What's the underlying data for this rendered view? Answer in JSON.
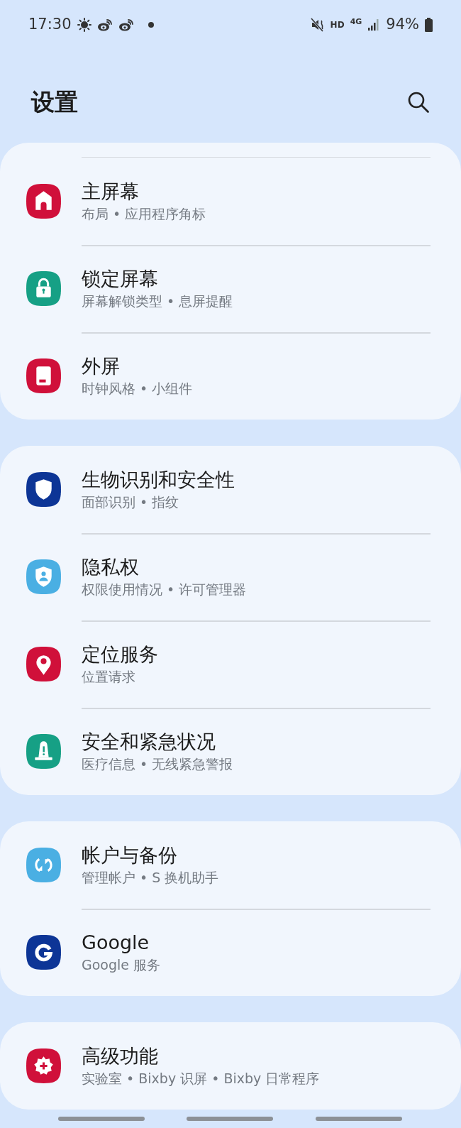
{
  "status_bar": {
    "time": "17:30",
    "hd": "HD",
    "network": "4G",
    "battery": "94%"
  },
  "header": {
    "title": "设置"
  },
  "groups": [
    {
      "clipped_top": true,
      "items": [
        {
          "title": "主屏幕",
          "subtitle": "布局 • 应用程序角标",
          "kind": "home",
          "color": "#d0103a"
        },
        {
          "title": "锁定屏幕",
          "subtitle": "屏幕解锁类型 • 息屏提醒",
          "kind": "lock",
          "color": "#16a085"
        },
        {
          "title": "外屏",
          "subtitle": "时钟风格 • 小组件",
          "kind": "cover",
          "color": "#d0103a"
        }
      ]
    },
    {
      "clipped_top": false,
      "items": [
        {
          "title": "生物识别和安全性",
          "subtitle": "面部识别 • 指纹",
          "kind": "shield",
          "color": "#0d3596"
        },
        {
          "title": "隐私权",
          "subtitle": "权限使用情况 • 许可管理器",
          "kind": "privacy",
          "color": "#4aafe3"
        },
        {
          "title": "定位服务",
          "subtitle": "位置请求",
          "kind": "pin",
          "color": "#d0103a"
        },
        {
          "title": "安全和紧急状况",
          "subtitle": "医疗信息 • 无线紧急警报",
          "kind": "alert",
          "color": "#16a085"
        }
      ]
    },
    {
      "clipped_top": false,
      "items": [
        {
          "title": "帐户与备份",
          "subtitle": "管理帐户 • S 换机助手",
          "kind": "sync",
          "color": "#4aafe3"
        },
        {
          "title": "Google",
          "subtitle": "Google 服务",
          "kind": "google",
          "color": "#0d3596"
        }
      ]
    },
    {
      "clipped_top": false,
      "items": [
        {
          "title": "高级功能",
          "subtitle": "实验室 • Bixby 识屏 • Bixby 日常程序",
          "kind": "gear",
          "color": "#d0103a"
        }
      ]
    }
  ]
}
